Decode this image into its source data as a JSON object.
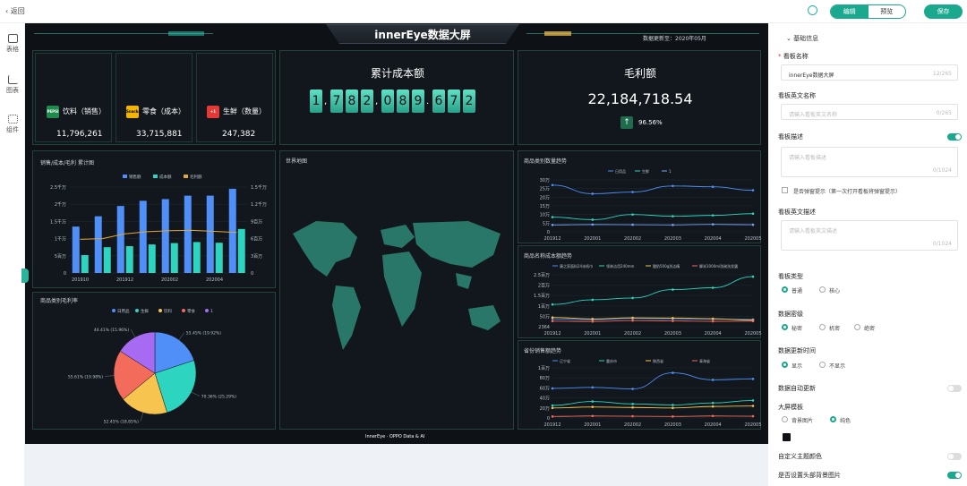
{
  "topbar": {
    "back_label": "返回",
    "edit_label": "编辑",
    "preview_label": "预览",
    "save_label": "保存"
  },
  "rail": [
    {
      "icon": "table-icon",
      "label": "表格"
    },
    {
      "icon": "chart-icon",
      "label": "图表"
    },
    {
      "icon": "component-icon",
      "label": "组件"
    }
  ],
  "board": {
    "title": "innerEye数据大屏",
    "update_time": "数据更新至：2020年05月",
    "footer": "InnerEye · OPPO Data & AI",
    "kpis": [
      {
        "icon_label": "PEPSI",
        "label": "饮料（销售）",
        "value": "11,796,261",
        "color": "#1f8a4c"
      },
      {
        "icon_label": "Snacks",
        "label": "零食（成本）",
        "value": "33,715,881",
        "color": "#f4b400"
      },
      {
        "icon_label": "+1",
        "label": "生鲜（数量）",
        "value": "247,382",
        "color": "#e53935"
      }
    ],
    "cumulative_cost": {
      "title": "累计成本额",
      "digits": [
        "1",
        "7",
        "8",
        "2",
        "0",
        "8",
        "9",
        "6",
        "7",
        "2"
      ],
      "separators": [
        ",",
        ",",
        "."
      ]
    },
    "gross_profit": {
      "title": "毛利额",
      "value": "22,184,718.54",
      "change": "96.56%"
    },
    "map_title": "世界地图"
  },
  "chart_data": [
    {
      "type": "bar",
      "title": "销售/成本/毛利 累计图",
      "categories": [
        "201910",
        "201911",
        "201912",
        "202001",
        "202002",
        "202003",
        "202004",
        "202005"
      ],
      "series": [
        {
          "name": "销售额",
          "values": [
            13500000,
            16500000,
            19500000,
            21000000,
            21500000,
            22500000,
            22500000,
            24500000
          ],
          "color": "#4f8ff7"
        },
        {
          "name": "成本额",
          "values": [
            5200000,
            7500000,
            7800000,
            8300000,
            8700000,
            9000000,
            8800000,
            12800000
          ],
          "color": "#2dd4bf"
        },
        {
          "name": "毛利额",
          "type": "line",
          "values": [
            9800000,
            10000000,
            11400000,
            12000000,
            12300000,
            12400000,
            12100000,
            11800000
          ],
          "color": "#e3a63a"
        }
      ],
      "xtick_labels": [
        "201910",
        "201912",
        "202002",
        "202004"
      ],
      "yticks_left": [
        "0",
        "5百万",
        "1千万",
        "1.5千万",
        "2千万",
        "2.5千万"
      ],
      "yticks_right": [
        "0",
        "3百万",
        "6百万",
        "9百万",
        "1.2千万",
        "1.5千万"
      ],
      "ylim": [
        0,
        25000000
      ]
    },
    {
      "type": "pie",
      "title": "商品类别毛利率",
      "legend": [
        "日用品",
        "生鲜",
        "饮料",
        "零食",
        "1"
      ],
      "slices": [
        {
          "name": "日用品",
          "value": 19.92,
          "label": "55.45% (19.92%)",
          "color": "#4f8ff7"
        },
        {
          "name": "生鲜",
          "value": 25.29,
          "label": "70.36% (25.29%)",
          "color": "#2dd4bf"
        },
        {
          "name": "饮料",
          "value": 18.85,
          "label": "52.45% (18.85%)",
          "color": "#f7c44f"
        },
        {
          "name": "零食",
          "value": 19.98,
          "label": "55.61% (19.98%)",
          "color": "#f26b5b"
        },
        {
          "name": "1",
          "value": 15.96,
          "label": "44.41% (15.96%)",
          "color": "#a66bf2"
        }
      ]
    },
    {
      "type": "line",
      "title": "商品类别数量趋势",
      "categories": [
        "201912",
        "202001",
        "202002",
        "202003",
        "202004",
        "202005"
      ],
      "series": [
        {
          "name": "日用品",
          "values": [
            27000,
            22000,
            23000,
            26500,
            26000,
            24000
          ],
          "color": "#4f8ff7"
        },
        {
          "name": "生鲜",
          "values": [
            8500,
            7000,
            10000,
            9000,
            9500,
            10500
          ],
          "color": "#2dd4bf"
        },
        {
          "name": "1",
          "values": [
            4000,
            4200,
            4100,
            4000,
            4300,
            4100
          ],
          "color": "#7aa4f5"
        }
      ],
      "yticks": [
        "0",
        "5万",
        "10万",
        "15万",
        "20万",
        "25万",
        "30万"
      ],
      "ylim": [
        0,
        30000
      ]
    },
    {
      "type": "line",
      "title": "商品名称成本额趋势",
      "categories": [
        "201912",
        "202001",
        "202002",
        "202003",
        "202004",
        "202005"
      ],
      "series": [
        {
          "name": "康之家面料24米纸巾",
          "values": [
            420000,
            380000,
            450000,
            430000,
            410000,
            390000
          ],
          "color": "#4f8ff7"
        },
        {
          "name": "领林洁用240mm",
          "values": [
            1200000,
            1450000,
            1550000,
            2000000,
            2100000,
            2700000
          ],
          "color": "#2dd4bf"
        },
        {
          "name": "酸奶500g洗洁精",
          "values": [
            500000,
            420000,
            480000,
            470000,
            430000,
            350000
          ],
          "color": "#f7c44f"
        },
        {
          "name": "脚米1000ml洗碗洗发露",
          "values": [
            300000,
            280000,
            330000,
            310000,
            290000,
            300000
          ],
          "color": "#f26b5b"
        }
      ],
      "yticks": [
        "2364",
        "50万",
        "1百万",
        "1.5百万",
        "2百万",
        "2.5百万"
      ],
      "ylim": [
        0,
        2800000
      ]
    },
    {
      "type": "line",
      "title": "省份销售额趋势",
      "categories": [
        "201912",
        "202001",
        "202002",
        "202003",
        "202004",
        "202005"
      ],
      "series": [
        {
          "name": "辽宁省",
          "values": [
            590000,
            610000,
            580000,
            900000,
            760000,
            780000
          ],
          "color": "#4f8ff7"
        },
        {
          "name": "重庆市",
          "values": [
            250000,
            330000,
            280000,
            260000,
            300000,
            350000
          ],
          "color": "#2dd4bf"
        },
        {
          "name": "陕西省",
          "values": [
            200000,
            220000,
            210000,
            200000,
            230000,
            240000
          ],
          "color": "#f7c44f"
        },
        {
          "name": "青海省",
          "values": [
            30000,
            40000,
            35000,
            30000,
            40000,
            35000
          ],
          "color": "#f26b5b"
        }
      ],
      "yticks": [
        "0",
        "20万",
        "40万",
        "60万",
        "80万",
        "1百万"
      ],
      "ylim": [
        0,
        1000000
      ]
    }
  ],
  "side": {
    "section": "基础信息",
    "name_label": "看板名称",
    "name_value": "innerEye数据大屏",
    "name_count": "12/265",
    "en_name_label": "看板英文名称",
    "en_name_placeholder": "请输入看板英文名称",
    "en_name_count": "0/265",
    "desc_label": "看板描述",
    "desc_placeholder": "请输入看板描述",
    "desc_count": "0/1024",
    "popup_label": "是否弹窗提示（第一次打开看板将弹窗提示）",
    "en_desc_label": "看板英文描述",
    "en_desc_placeholder": "请输入看板英文描述",
    "en_desc_count": "0/1024",
    "type_label": "看板类型",
    "type_options": [
      "普通",
      "核心"
    ],
    "secret_label": "数据密级",
    "secret_options": [
      "秘密",
      "机密",
      "绝密"
    ],
    "update_label": "数据更新时间",
    "update_options": [
      "显示",
      "不显示"
    ],
    "auto_update_label": "数据自动更新",
    "template_label": "大屏模板",
    "template_options": [
      "背景图片",
      "纯色"
    ],
    "theme_label": "自定义主题颜色",
    "header_bg_label": "是否设置头部背景图片"
  }
}
